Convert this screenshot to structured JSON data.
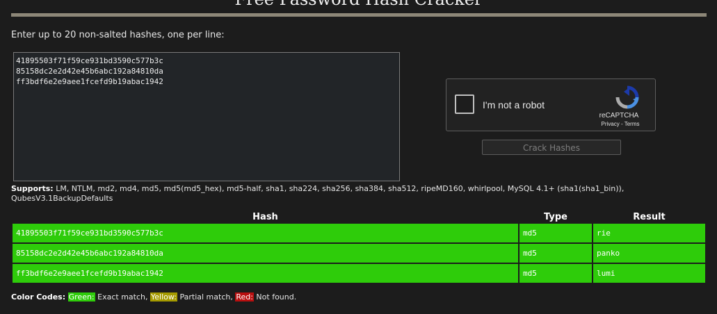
{
  "header": {
    "title": "Free Password Hash Cracker"
  },
  "form": {
    "instructions": "Enter up to 20 non-salted hashes, one per line:",
    "hashes_value": "41895503f71f59ce931bd3590c577b3c\n85158dc2e2d42e45b6abc192a84810da\nff3bdf6e2e9aee1fcefd9b19abac1942",
    "submit_label": "Crack Hashes"
  },
  "captcha": {
    "label": "I'm not a robot",
    "brand": "reCAPTCHA",
    "privacy": "Privacy",
    "separator": " - ",
    "terms": "Terms"
  },
  "supports": {
    "label": "Supports:",
    "text": " LM, NTLM, md2, md4, md5, md5(md5_hex), md5-half, sha1, sha224, sha256, sha384, sha512, ripeMD160, whirlpool, MySQL 4.1+ (sha1(sha1_bin)), QubesV3.1BackupDefaults"
  },
  "results": {
    "columns": [
      "Hash",
      "Type",
      "Result"
    ],
    "rows": [
      {
        "hash": "41895503f71f59ce931bd3590c577b3c",
        "type": "md5",
        "result": "rie",
        "status": "exact"
      },
      {
        "hash": "85158dc2e2d42e45b6abc192a84810da",
        "type": "md5",
        "result": "panko",
        "status": "exact"
      },
      {
        "hash": "ff3bdf6e2e9aee1fcefd9b19abac1942",
        "type": "md5",
        "result": "lumi",
        "status": "exact"
      }
    ]
  },
  "legend": {
    "label": "Color Codes:",
    "green": "Green:",
    "green_text": " Exact match, ",
    "yellow": "Yellow:",
    "yellow_text": " Partial match, ",
    "red": "Red:",
    "red_text": " Not found."
  },
  "colors": {
    "exact": "#2ecc0a",
    "partial": "#a59a00",
    "not_found": "#b80f0f",
    "rule": "#8d8778"
  }
}
